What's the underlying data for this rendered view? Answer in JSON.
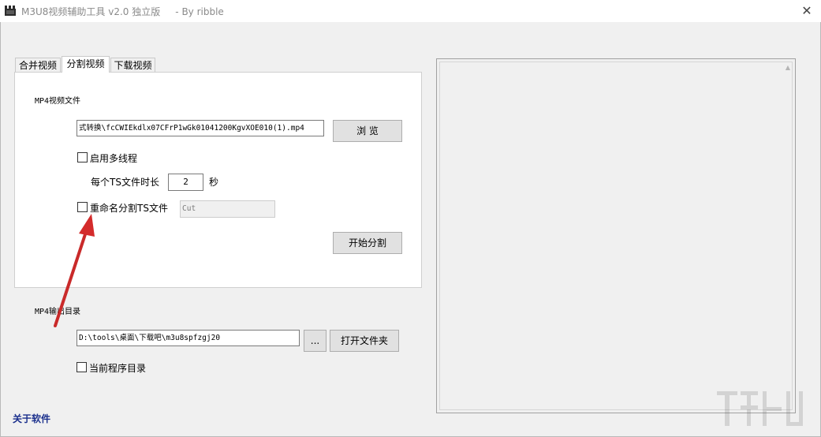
{
  "window": {
    "title": "M3U8视频辅助工具 v2.0 独立版     - By ribble",
    "close_glyph": "✕"
  },
  "tabs": [
    {
      "label": "合并视频",
      "active": false
    },
    {
      "label": "分割视频",
      "active": true
    },
    {
      "label": "下载视频",
      "active": false
    }
  ],
  "split": {
    "mp4_label": "MP4视频文件",
    "file_path": "式转换\\fcCWIEkdlx07CFrP1wGk01041200KgvXOE010(1).mp4",
    "browse_button": "浏 览",
    "multithread_label": "启用多线程",
    "multithread_checked": false,
    "ts_duration_label": "每个TS文件时长",
    "ts_duration_value": "2",
    "ts_duration_unit": "秒",
    "rename_label": "重命名分割TS文件",
    "rename_checked": false,
    "rename_placeholder": "Cut",
    "start_button": "开始分割"
  },
  "output": {
    "label": "MP4输出目录",
    "path": "D:\\tools\\桌面\\下载吧\\m3u8spfzgj20",
    "browse_button": "...",
    "open_folder_button": "打开文件夹",
    "current_dir_label": "当前程序目录",
    "current_dir_checked": false
  },
  "about_link": "关于软件",
  "colors": {
    "annotation_arrow": "#d42b2b",
    "about_link": "#1a2f8c"
  }
}
